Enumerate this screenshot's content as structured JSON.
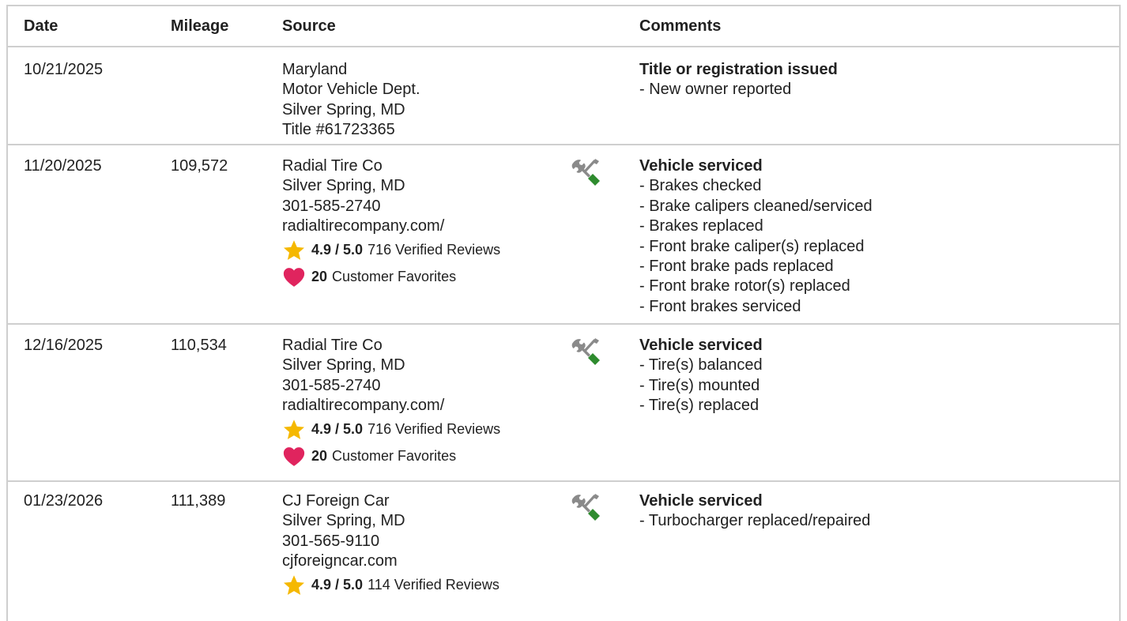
{
  "table": {
    "headers": {
      "date": "Date",
      "mileage": "Mileage",
      "source": "Source",
      "comments": "Comments"
    },
    "rows": [
      {
        "date": "10/21/2025",
        "mileage": "",
        "source": [
          "Maryland",
          "Motor Vehicle Dept.",
          "Silver Spring, MD",
          "Title #61723365"
        ],
        "icon": "",
        "comment_title": "Title or registration issued",
        "comments": [
          "- New owner reported"
        ]
      },
      {
        "date": "11/20/2025",
        "mileage": "109,572",
        "source": [
          "Radial Tire Co",
          "Silver Spring, MD",
          "301-585-2740",
          "radialtirecompany.com/"
        ],
        "rating": {
          "score": "4.9 / 5.0",
          "reviews": "716 Verified Reviews"
        },
        "favorites": {
          "count": "20",
          "label": "Customer Favorites"
        },
        "icon": "wrench-screwdriver-icon",
        "comment_title": "Vehicle serviced",
        "comments": [
          "- Brakes checked",
          "- Brake calipers cleaned/serviced",
          "- Brakes replaced",
          "- Front brake caliper(s) replaced",
          "- Front brake pads replaced",
          "- Front brake rotor(s) replaced",
          "- Front brakes serviced"
        ]
      },
      {
        "date": "12/16/2025",
        "mileage": "110,534",
        "source": [
          "Radial Tire Co",
          "Silver Spring, MD",
          "301-585-2740",
          "radialtirecompany.com/"
        ],
        "rating": {
          "score": "4.9 / 5.0",
          "reviews": "716 Verified Reviews"
        },
        "favorites": {
          "count": "20",
          "label": "Customer Favorites"
        },
        "icon": "wrench-screwdriver-icon",
        "comment_title": "Vehicle serviced",
        "comments": [
          "- Tire(s) balanced",
          "- Tire(s) mounted",
          "- Tire(s) replaced"
        ]
      },
      {
        "date": "01/23/2026",
        "mileage": "111,389",
        "source": [
          "CJ Foreign Car",
          "Silver Spring, MD",
          "301-565-9110",
          "cjforeigncar.com"
        ],
        "rating": {
          "score": "4.9 / 5.0",
          "reviews": "114 Verified Reviews"
        },
        "icon": "wrench-screwdriver-icon",
        "comment_title": "Vehicle serviced",
        "comments": [
          "- Turbocharger replaced/repaired"
        ]
      }
    ]
  },
  "colors": {
    "star": "#f5b800",
    "heart": "#e0245e",
    "tool_gray": "#8a8a8a",
    "tool_green": "#2e8b2e",
    "border": "#cfcfcf"
  }
}
